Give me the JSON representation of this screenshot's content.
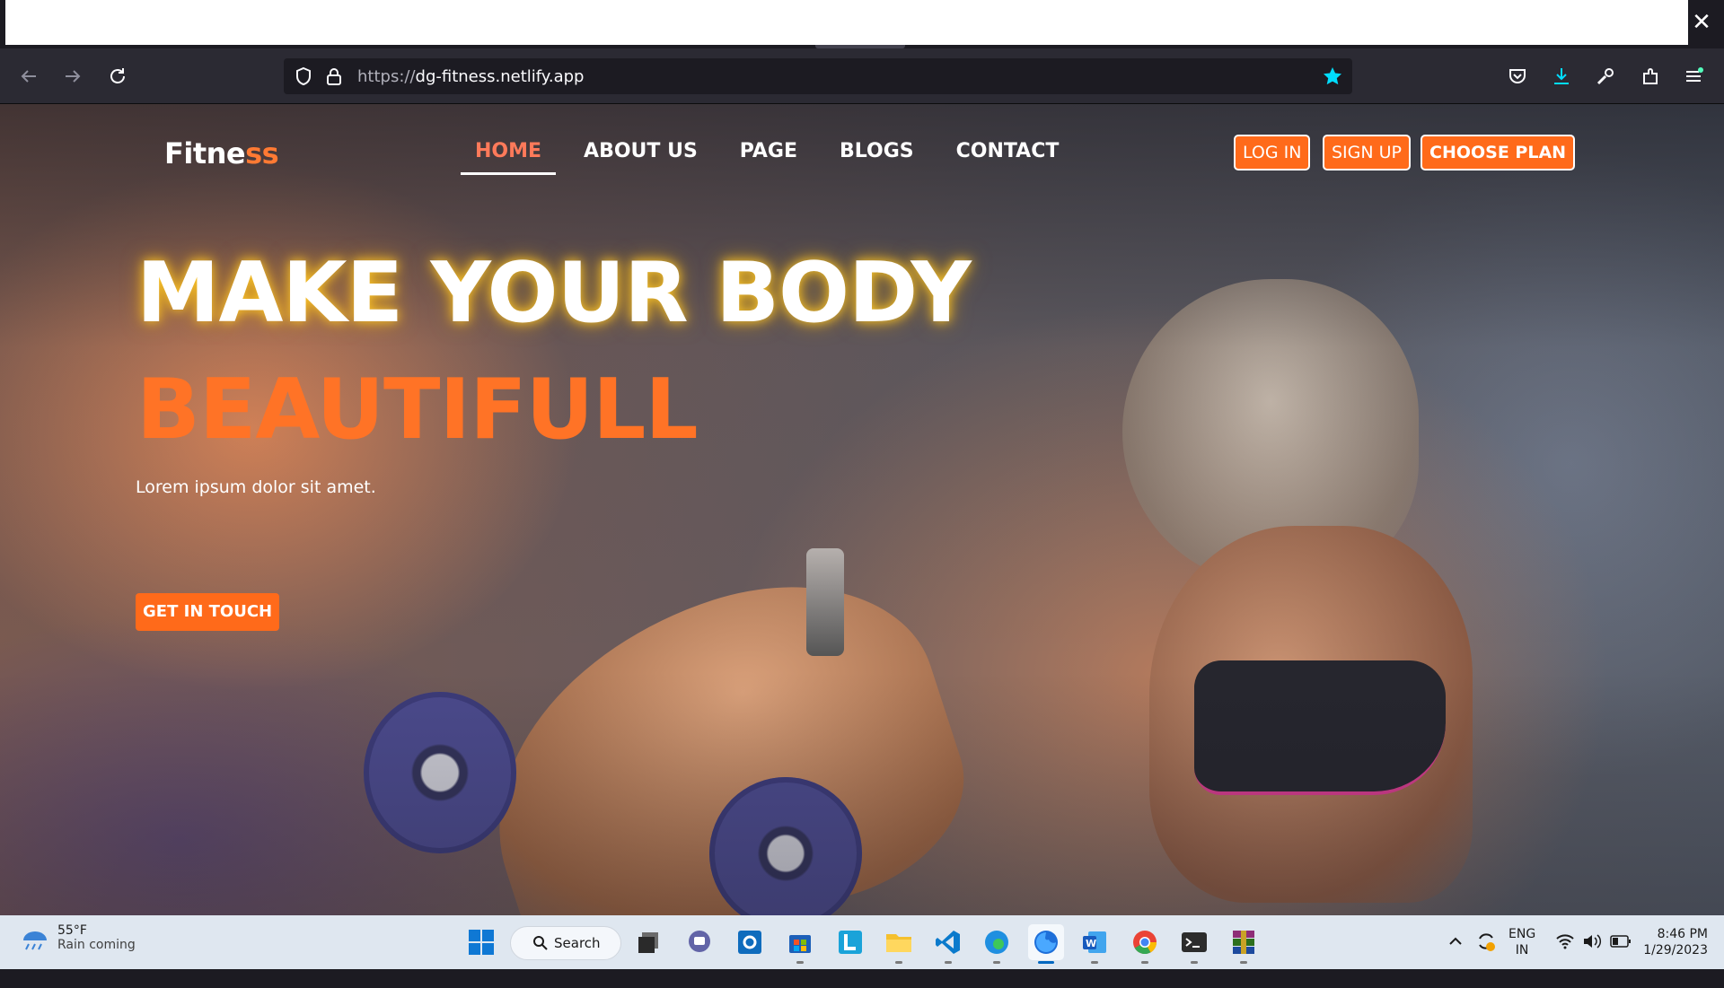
{
  "browser": {
    "url_protocol": "https://",
    "url_host": "dg-fitness.netlify.app",
    "close_glyph": "✕",
    "back_icon": "arrow-left-icon",
    "forward_icon": "arrow-right-icon",
    "reload_icon": "reload-icon",
    "bookmark_icon": "star-filled-icon",
    "accent_color": "#00ddff"
  },
  "site": {
    "logo_main": "Fitne",
    "logo_accent": "ss",
    "nav": [
      {
        "label": "HOME",
        "active": true
      },
      {
        "label": "ABOUT US",
        "active": false
      },
      {
        "label": "PAGE",
        "active": false
      },
      {
        "label": "BLOGS",
        "active": false
      },
      {
        "label": "CONTACT",
        "active": false
      }
    ],
    "login_label": "LOG IN",
    "signup_label": "SIGN UP",
    "plan_label": "CHOOSE PLAN",
    "brand_color": "#ff6a1a"
  },
  "hero": {
    "headline_1": "MAKE YOUR BODY",
    "headline_2": "BEAUTIFULL",
    "subtitle": "Lorem ipsum dolor sit amet.",
    "cta_label": "GET IN TOUCH"
  },
  "taskbar": {
    "weather_temp": "55°F",
    "weather_cond": "Rain coming",
    "search_label": "Search",
    "lang_1": "ENG",
    "lang_2": "IN",
    "time": "8:46 PM",
    "date": "1/29/2023",
    "apps": [
      "windows-start-icon",
      "task-view-icon",
      "teams-chat-icon",
      "outlook-icon",
      "microsoft-store-icon",
      "l-app-icon",
      "file-explorer-icon",
      "vscode-icon",
      "edge-icon",
      "firefox-icon",
      "word-icon",
      "chrome-icon",
      "terminal-icon",
      "winrar-icon"
    ]
  }
}
